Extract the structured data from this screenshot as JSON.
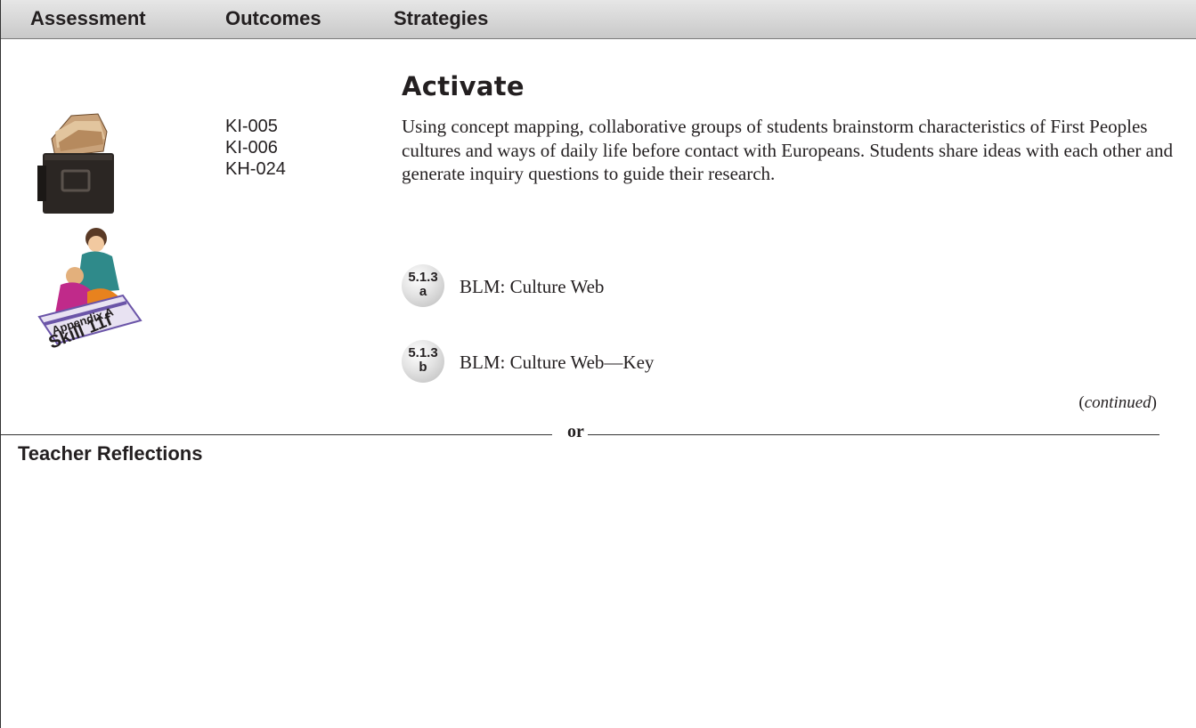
{
  "header": {
    "col_assessment": "Assessment",
    "col_outcomes": "Outcomes",
    "col_strategies": "Strategies"
  },
  "section_title": "Activate",
  "outcomes": [
    "KI-005",
    "KI-006",
    "KH-024"
  ],
  "body_text": "Using concept mapping, collaborative groups of students brainstorm characteristics of First Peoples cultures and ways of daily life before contact with Europeans. Students share ideas with each other and generate inquiry questions to guide their research.",
  "blm_items": [
    {
      "number": "5.1.3",
      "letter": "a",
      "label": "BLM: Culture Web"
    },
    {
      "number": "5.1.3",
      "letter": "b",
      "label": "BLM: Culture Web—Key"
    }
  ],
  "appendix_icon": {
    "line1": "Appendix A",
    "line2": "Skill 11f"
  },
  "icons": {
    "portfolio": "briefcase-portfolio-icon",
    "appendix": "teacher-student-appendix-icon"
  },
  "continued_label": "continued",
  "divider_label": "or",
  "reflections_title": "Teacher Reflections"
}
